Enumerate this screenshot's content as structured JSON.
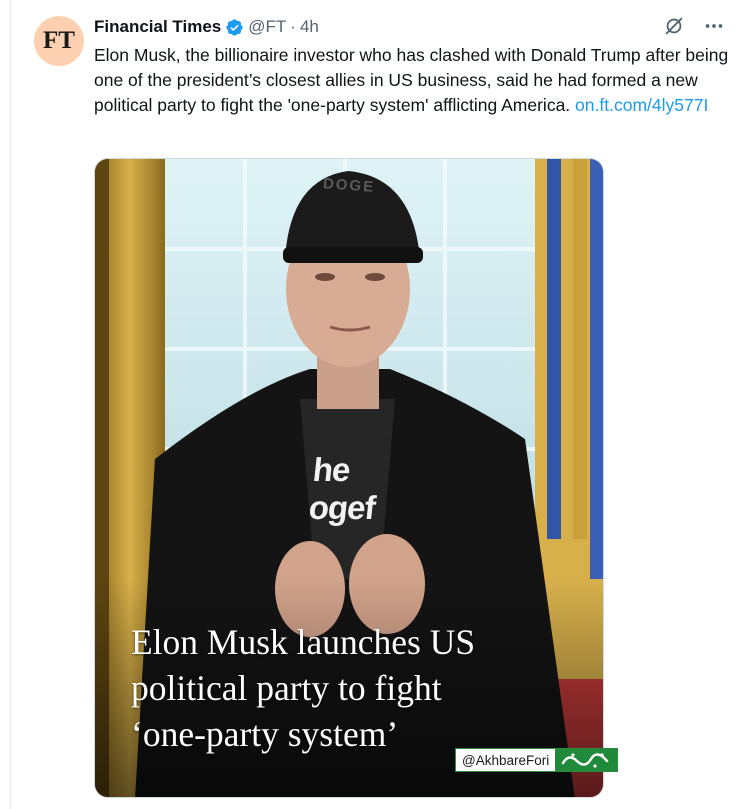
{
  "tweet": {
    "avatar_text": "FT",
    "author_name": "Financial Times",
    "handle": "@FT",
    "separator": "·",
    "time": "4h",
    "text_body": "Elon Musk, the billionaire investor who has clashed with Donald Trump after being one of the president’s closest allies in US business, said he had formed a new political party to fight the 'one-party system' afflicting America.",
    "link_text": "on.ft.com/4ly577I",
    "icons": {
      "verified": "verified-badge-icon",
      "grok": "grok-icon",
      "more": "more-icon"
    }
  },
  "media": {
    "headline_line1": "Elon Musk launches US",
    "headline_line2": "political party to fight",
    "headline_line3": "‘one-party system’",
    "shirt_line1": "he",
    "shirt_line2": "ogef",
    "cap_text": "DOGE"
  },
  "watermark": {
    "handle": "@AkhbareFori",
    "logo_text": "خبر فوری"
  },
  "colors": {
    "link": "#1d9bf0",
    "verified": "#1d9bf0",
    "secondary_text": "#536471",
    "avatar_bg": "#fcd0b1",
    "watermark_green": "#1f8a3a"
  }
}
